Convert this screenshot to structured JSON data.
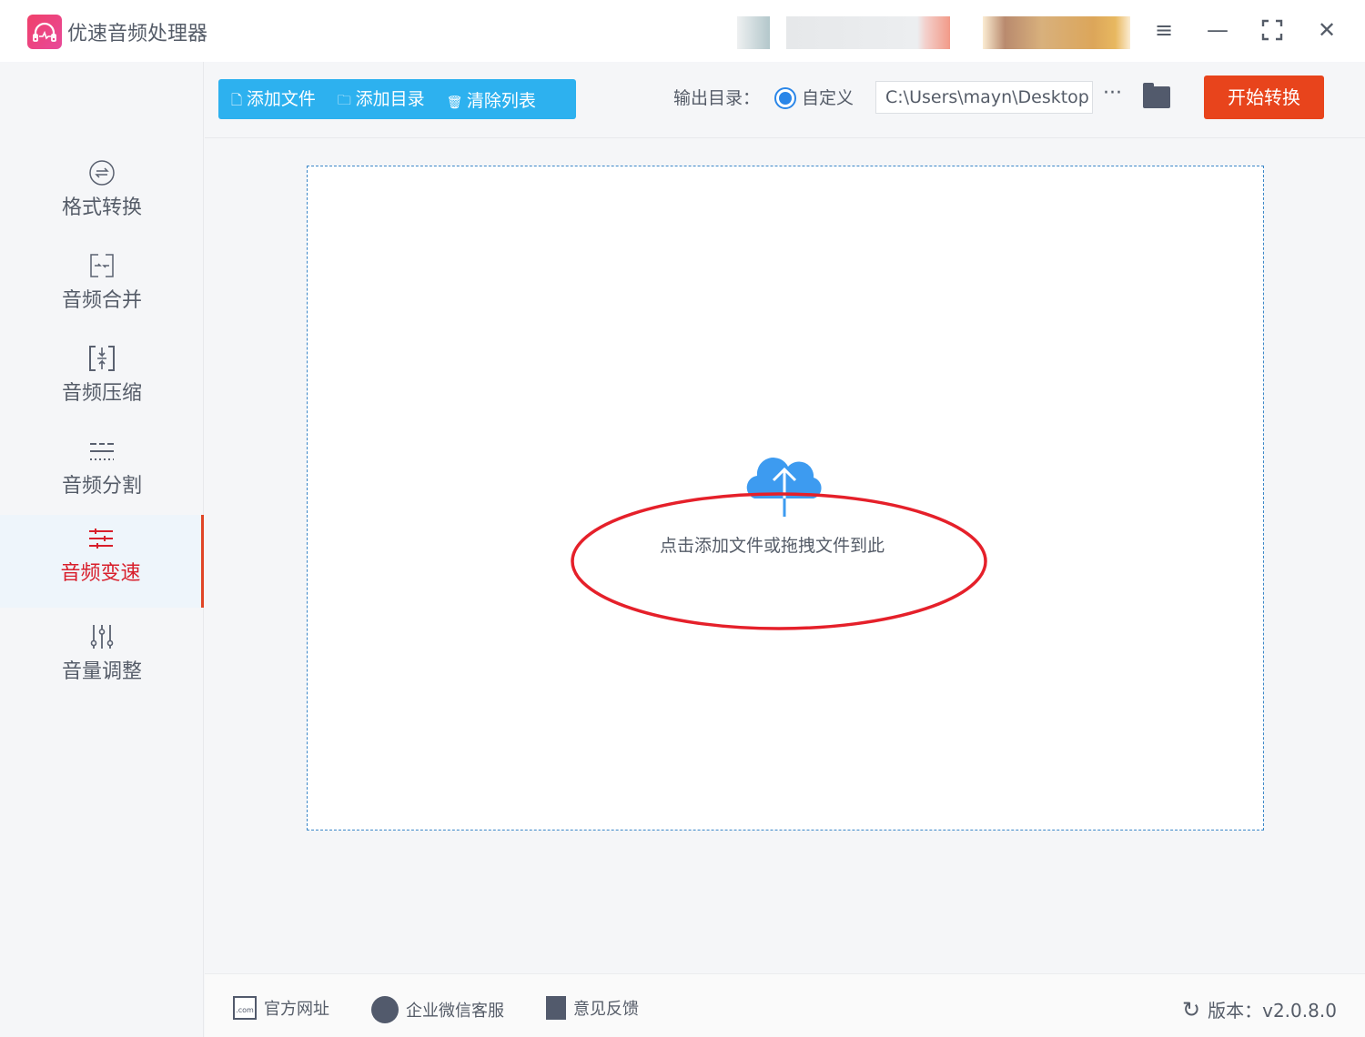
{
  "app": {
    "title": "优速音频处理器"
  },
  "window": {
    "menu_icon": "hamburger-icon",
    "minimize_icon": "minimize-icon",
    "maximize_icon": "maximize-icon",
    "close_icon": "close-icon"
  },
  "sidebar": {
    "items": [
      {
        "label": "格式转换",
        "icon": "convert-icon"
      },
      {
        "label": "音频合并",
        "icon": "merge-icon"
      },
      {
        "label": "音频压缩",
        "icon": "compress-icon"
      },
      {
        "label": "音频分割",
        "icon": "split-icon"
      },
      {
        "label": "音频变速",
        "icon": "speed-icon",
        "active": true
      },
      {
        "label": "音量调整",
        "icon": "volume-icon"
      }
    ]
  },
  "toolbar": {
    "add_file": "添加文件",
    "add_folder": "添加目录",
    "clear_list": "清除列表",
    "output_label": "输出目录：",
    "radio_custom": "自定义",
    "output_path": "C:\\Users\\mayn\\Desktop",
    "more": "···",
    "start": "开始转换"
  },
  "dropzone": {
    "hint": "点击添加文件或拖拽文件到此"
  },
  "footer": {
    "website": "官方网址",
    "wechat": "企业微信客服",
    "feedback": "意见反馈",
    "version": "版本：v2.0.8.0",
    "website_icon_text": ".com"
  },
  "colors": {
    "accent": "#2db1ef",
    "start": "#e8441c",
    "active": "#d81e2b",
    "annotation": "#e5202a"
  }
}
